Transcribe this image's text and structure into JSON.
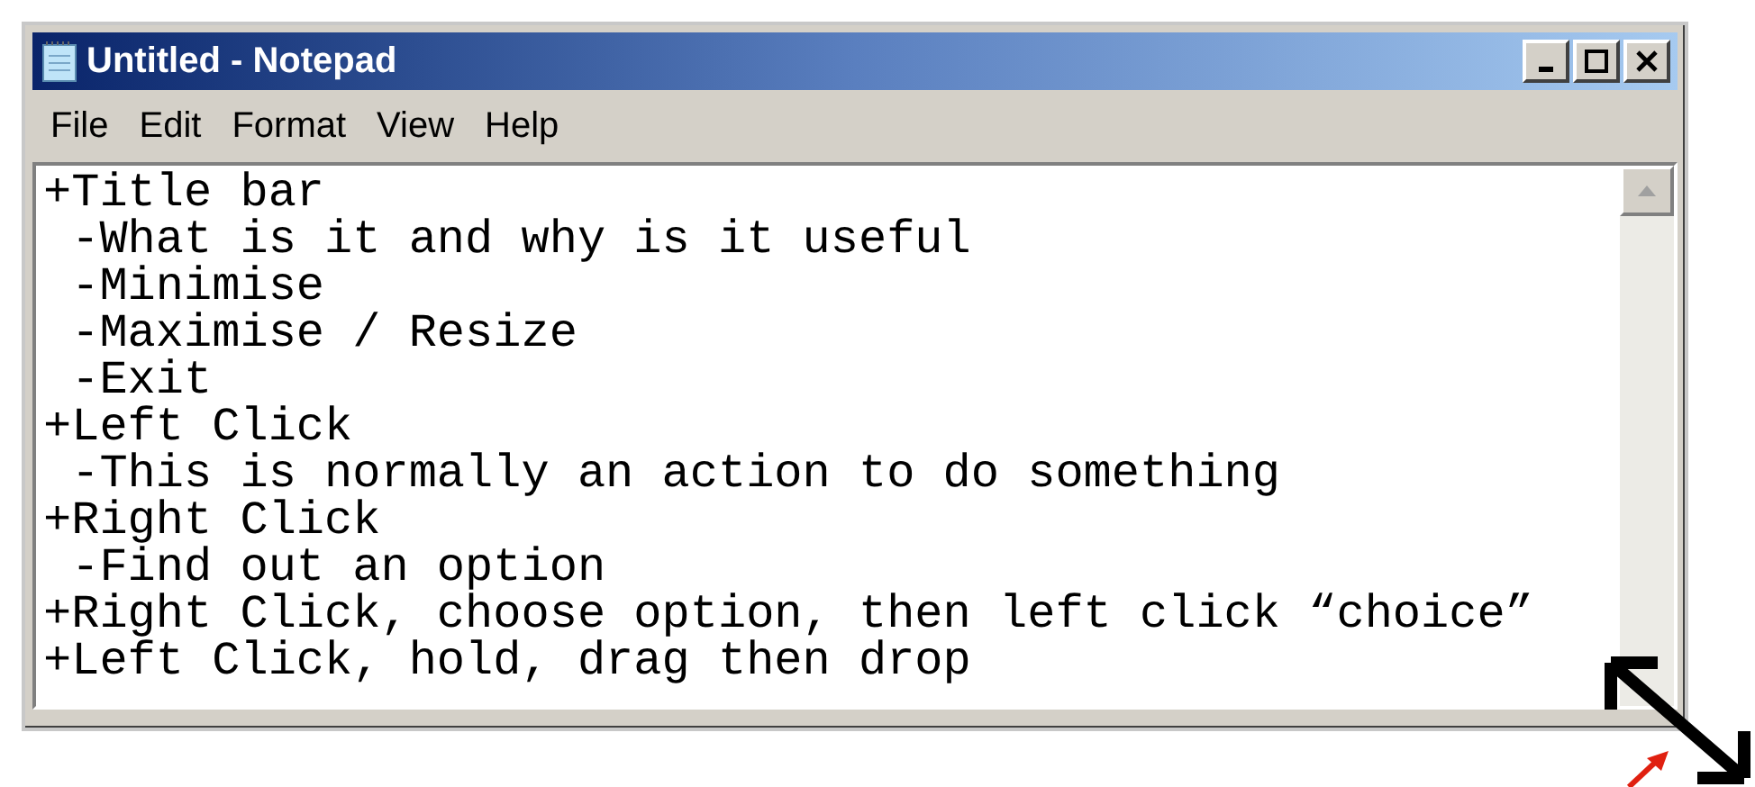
{
  "window": {
    "title": "Untitled - Notepad"
  },
  "menu": [
    "File",
    "Edit",
    "Format",
    "View",
    "Help"
  ],
  "lines": [
    "+Title bar",
    " -What is it and why is it useful",
    " -Minimise",
    " -Maximise / Resize",
    " -Exit",
    "+Left Click",
    " -This is normally an action to do something",
    "+Right Click",
    " -Find out an option",
    "+Right Click, choose option, then left click “choice”",
    "+Left Click, hold, drag then drop"
  ]
}
